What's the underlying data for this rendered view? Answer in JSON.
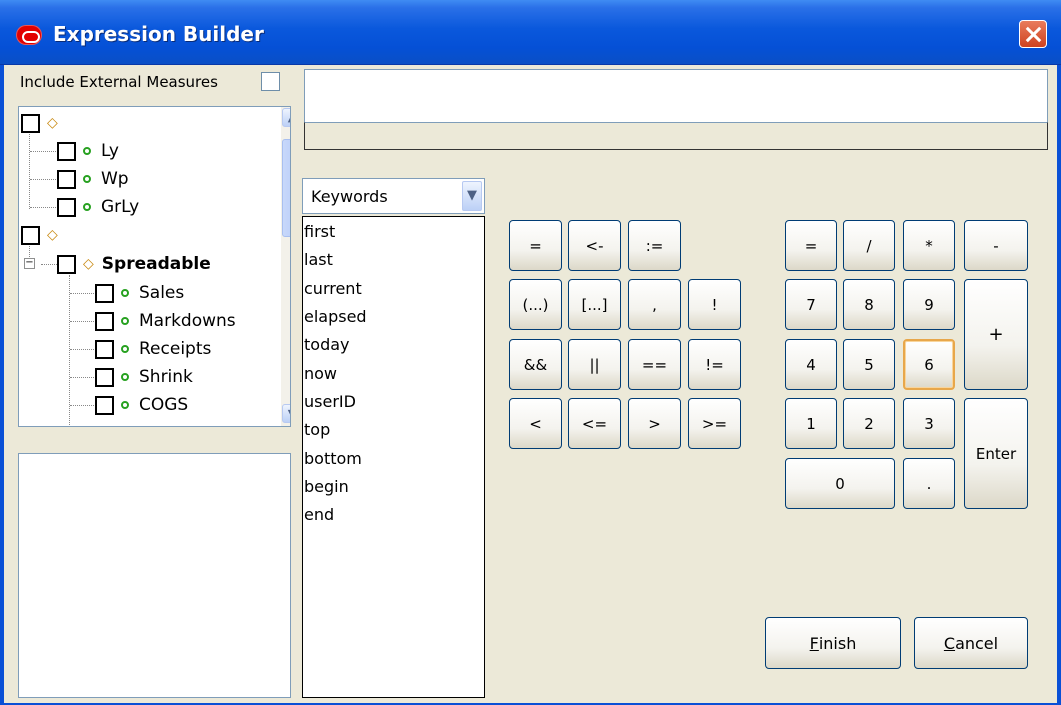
{
  "window": {
    "title": "Expression Builder",
    "close_label": "×"
  },
  "external": {
    "label": "Include External Measures",
    "checked": false
  },
  "tree": {
    "groups": [
      {
        "kind": "group",
        "label": "",
        "children": [
          "Ly",
          "Wp",
          "GrLy"
        ]
      },
      {
        "kind": "group",
        "label": "",
        "children": []
      },
      {
        "kind": "subgroup",
        "label": "Spreadable",
        "children": [
          "Sales",
          "Markdowns",
          "Receipts",
          "Shrink",
          "COGS"
        ]
      }
    ]
  },
  "keywords": {
    "selected": "Keywords",
    "items": [
      "first",
      "last",
      "current",
      "elapsed",
      "today",
      "now",
      "userID",
      "top",
      "bottom",
      "begin",
      "end"
    ]
  },
  "operators": {
    "row1": [
      "=",
      "<-",
      ":="
    ],
    "row2": [
      "(...)",
      "[...]",
      ",",
      "!"
    ],
    "row3": [
      "&&",
      "||",
      "==",
      "!="
    ],
    "row4": [
      "<",
      "<=",
      ">",
      ">="
    ]
  },
  "keypad": {
    "top": [
      "=",
      "/",
      "*",
      "-"
    ],
    "r1": [
      "7",
      "8",
      "9"
    ],
    "r2": [
      "4",
      "5",
      "6"
    ],
    "r3": [
      "1",
      "2",
      "3"
    ],
    "zero": "0",
    "dot": ".",
    "plus": "+",
    "enter": "Enter"
  },
  "actions": {
    "finish_first": "F",
    "finish_rest": "inish",
    "cancel_first": "C",
    "cancel_rest": "ancel"
  }
}
